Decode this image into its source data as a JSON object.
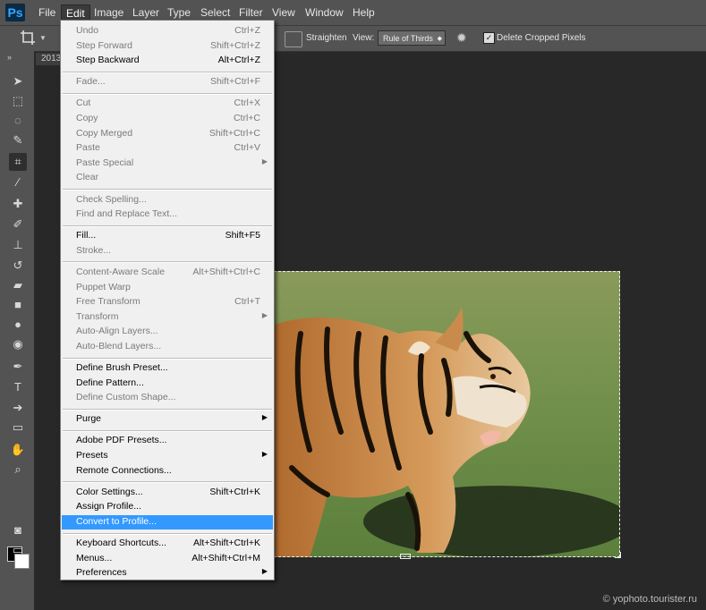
{
  "menubar": {
    "logo": "Ps",
    "items": [
      "File",
      "Edit",
      "Image",
      "Layer",
      "Type",
      "Select",
      "Filter",
      "View",
      "Window",
      "Help"
    ],
    "active": "Edit"
  },
  "options_bar": {
    "straighten_label": "Straighten",
    "view_label": "View:",
    "view_value": "Rule of Thirds",
    "delete_cropped_label": "Delete Cropped Pixels",
    "delete_cropped_checked": true
  },
  "document_tab": {
    "title": "2013"
  },
  "edit_menu": {
    "groups": [
      [
        {
          "label": "Undo",
          "shortcut": "Ctrl+Z",
          "disabled": true
        },
        {
          "label": "Step Forward",
          "shortcut": "Shift+Ctrl+Z",
          "disabled": true
        },
        {
          "label": "Step Backward",
          "shortcut": "Alt+Ctrl+Z",
          "disabled": false
        }
      ],
      [
        {
          "label": "Fade...",
          "shortcut": "Shift+Ctrl+F",
          "disabled": true
        }
      ],
      [
        {
          "label": "Cut",
          "shortcut": "Ctrl+X",
          "disabled": true
        },
        {
          "label": "Copy",
          "shortcut": "Ctrl+C",
          "disabled": true
        },
        {
          "label": "Copy Merged",
          "shortcut": "Shift+Ctrl+C",
          "disabled": true
        },
        {
          "label": "Paste",
          "shortcut": "Ctrl+V",
          "disabled": true
        },
        {
          "label": "Paste Special",
          "shortcut": "",
          "submenu": true,
          "disabled": true
        },
        {
          "label": "Clear",
          "shortcut": "",
          "disabled": true
        }
      ],
      [
        {
          "label": "Check Spelling...",
          "shortcut": "",
          "disabled": true
        },
        {
          "label": "Find and Replace Text...",
          "shortcut": "",
          "disabled": true
        }
      ],
      [
        {
          "label": "Fill...",
          "shortcut": "Shift+F5",
          "disabled": false
        },
        {
          "label": "Stroke...",
          "shortcut": "",
          "disabled": true
        }
      ],
      [
        {
          "label": "Content-Aware Scale",
          "shortcut": "Alt+Shift+Ctrl+C",
          "disabled": true
        },
        {
          "label": "Puppet Warp",
          "shortcut": "",
          "disabled": true
        },
        {
          "label": "Free Transform",
          "shortcut": "Ctrl+T",
          "disabled": true
        },
        {
          "label": "Transform",
          "shortcut": "",
          "submenu": true,
          "disabled": true
        },
        {
          "label": "Auto-Align Layers...",
          "shortcut": "",
          "disabled": true
        },
        {
          "label": "Auto-Blend Layers...",
          "shortcut": "",
          "disabled": true
        }
      ],
      [
        {
          "label": "Define Brush Preset...",
          "shortcut": "",
          "disabled": false
        },
        {
          "label": "Define Pattern...",
          "shortcut": "",
          "disabled": false
        },
        {
          "label": "Define Custom Shape...",
          "shortcut": "",
          "disabled": true
        }
      ],
      [
        {
          "label": "Purge",
          "shortcut": "",
          "submenu": true,
          "disabled": false
        }
      ],
      [
        {
          "label": "Adobe PDF Presets...",
          "shortcut": "",
          "disabled": false
        },
        {
          "label": "Presets",
          "shortcut": "",
          "submenu": true,
          "disabled": false
        },
        {
          "label": "Remote Connections...",
          "shortcut": "",
          "disabled": false
        }
      ],
      [
        {
          "label": "Color Settings...",
          "shortcut": "Shift+Ctrl+K",
          "disabled": false
        },
        {
          "label": "Assign Profile...",
          "shortcut": "",
          "disabled": false
        },
        {
          "label": "Convert to Profile...",
          "shortcut": "",
          "disabled": false,
          "highlighted": true
        }
      ],
      [
        {
          "label": "Keyboard Shortcuts...",
          "shortcut": "Alt+Shift+Ctrl+K",
          "disabled": false
        },
        {
          "label": "Menus...",
          "shortcut": "Alt+Shift+Ctrl+M",
          "disabled": false
        },
        {
          "label": "Preferences",
          "shortcut": "",
          "submenu": true,
          "disabled": false
        }
      ]
    ]
  },
  "tools": [
    "move-icon",
    "marquee-icon",
    "lasso-icon",
    "quick-select-icon",
    "crop-icon",
    "eyedropper-icon",
    "healing-icon",
    "brush-icon",
    "stamp-icon",
    "history-brush-icon",
    "eraser-icon",
    "gradient-icon",
    "blur-icon",
    "dodge-icon",
    "pen-icon",
    "type-icon",
    "path-select-icon",
    "rectangle-icon",
    "hand-icon",
    "zoom-icon"
  ],
  "active_tool": "crop-icon",
  "watermark": "© yophoto.tourister.ru"
}
